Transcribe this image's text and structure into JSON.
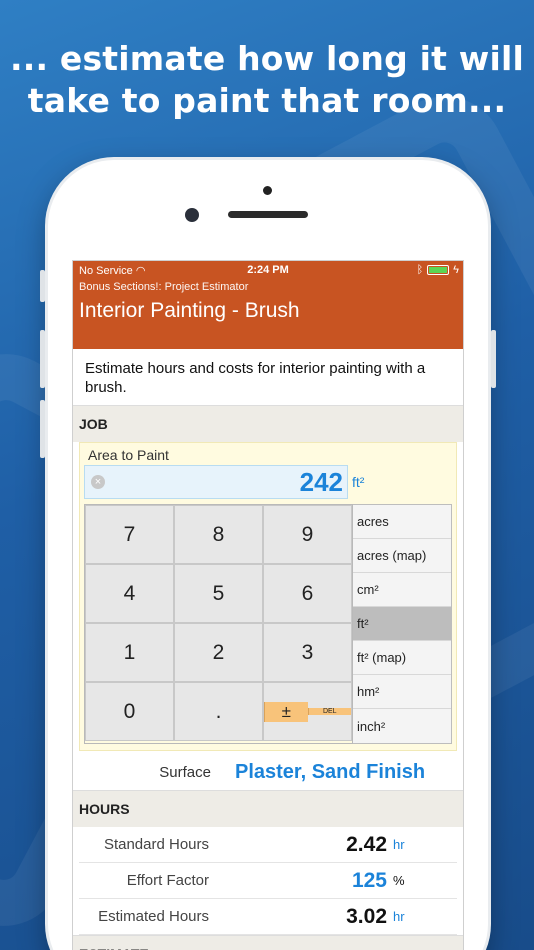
{
  "headline": "... estimate how long it will take to paint that room...",
  "status_bar": {
    "carrier": "No Service",
    "time": "2:24 PM",
    "wifi_icon": "wifi-icon",
    "bluetooth_icon": "bluetooth-icon"
  },
  "header": {
    "breadcrumb": "Bonus Sections!: Project Estimator",
    "title": "Interior Painting - Brush",
    "color": "#c85422"
  },
  "description": "Estimate hours and costs for interior painting with a brush.",
  "job": {
    "section_label": "JOB",
    "area_label": "Area to Paint",
    "area_value": "242",
    "area_unit": "ft²",
    "keys": [
      "7",
      "8",
      "9",
      "4",
      "5",
      "6",
      "1",
      "2",
      "3",
      "0",
      "."
    ],
    "plusminus": "±",
    "del": "DEL",
    "units": [
      "acres",
      "acres (map)",
      "cm²",
      "ft²",
      "ft² (map)",
      "hm²",
      "inch²"
    ],
    "selected_unit": "ft²",
    "surface_label": "Surface",
    "surface_value": "Plaster, Sand Finish"
  },
  "hours": {
    "section_label": "HOURS",
    "standard_label": "Standard Hours",
    "standard_value": "2.42",
    "standard_unit": "hr",
    "effort_label": "Effort Factor",
    "effort_value": "125",
    "effort_unit": "%",
    "estimated_label": "Estimated Hours",
    "estimated_value": "3.02",
    "estimated_unit": "hr"
  },
  "estimate": {
    "section_label": "ESTIMATE"
  },
  "colors": {
    "accent": "#1b83d9",
    "keypad_orange": "#f8c37a"
  }
}
